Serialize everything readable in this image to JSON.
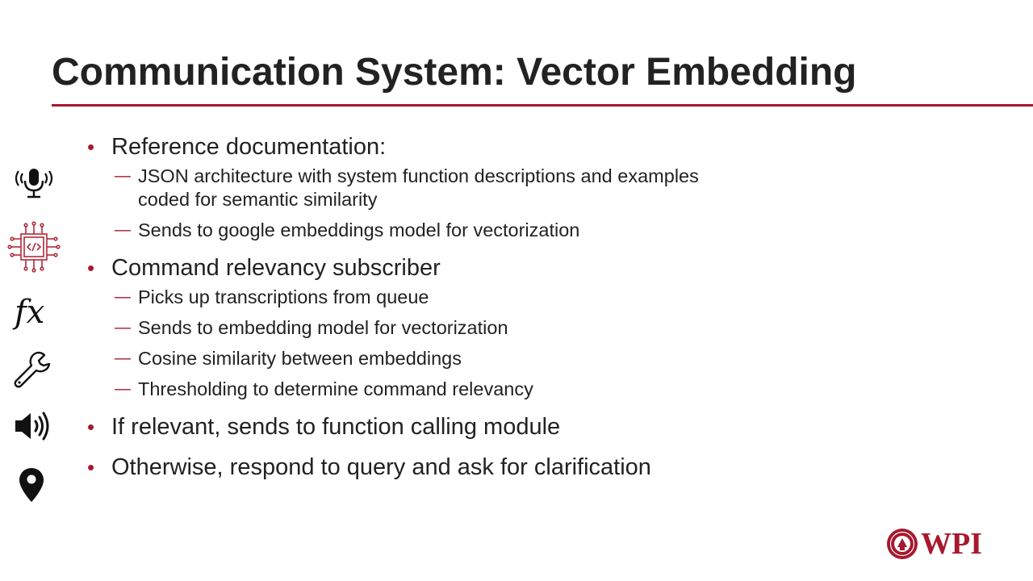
{
  "slide": {
    "title": "Communication System: Vector Embedding",
    "accent_color": "#a6192e"
  },
  "icons": [
    "microphone-icon",
    "circuit-chip-icon",
    "function-fx-icon",
    "wrench-icon",
    "speaker-icon",
    "location-pin-icon"
  ],
  "fx_glyph": "fx",
  "bullets": {
    "b1": {
      "text": "Reference documentation:",
      "subs": [
        {
          "lines": [
            "JSON architecture with system function descriptions and examples",
            "coded for semantic similarity"
          ]
        },
        {
          "lines": [
            "Sends to google embeddings model for vectorization"
          ]
        }
      ]
    },
    "b2": {
      "text": "Command relevancy subscriber",
      "subs": [
        {
          "lines": [
            "Picks up transcriptions from queue"
          ]
        },
        {
          "lines": [
            "Sends to embedding model for vectorization"
          ]
        },
        {
          "lines": [
            "Cosine similarity between embeddings"
          ]
        },
        {
          "lines": [
            "Thresholding to determine command relevancy"
          ]
        }
      ]
    },
    "b3": {
      "text": "If relevant, sends to function calling module"
    },
    "b4": {
      "text": "Otherwise, respond to query and ask for clarification"
    }
  },
  "logo": {
    "text": "WPI"
  }
}
